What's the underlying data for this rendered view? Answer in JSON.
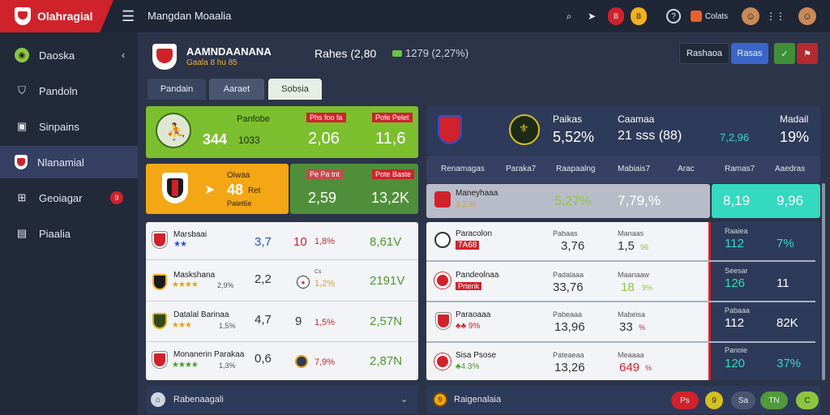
{
  "app": {
    "brand": "Olahragial",
    "page_title": "Mangdan Moaalia"
  },
  "topbar_icons": [
    {
      "name": "search-icon",
      "glyph": "🔍︎"
    },
    {
      "name": "share-icon",
      "glyph": "➤"
    },
    {
      "name": "red-badge-icon",
      "glyph": "B"
    },
    {
      "name": "coin-icon",
      "glyph": "B"
    },
    {
      "name": "help-icon",
      "glyph": "?"
    }
  ],
  "topbar_button": {
    "label": "Colats"
  },
  "sidebar": {
    "items": [
      {
        "label": "Daoska",
        "icon": "dashboard-icon",
        "arrow": "‹"
      },
      {
        "label": "Pandoln",
        "icon": "shield-outline-icon"
      },
      {
        "label": "Sinpains",
        "icon": "briefcase-icon"
      },
      {
        "label": "Nlanamial",
        "icon": "club-shield-icon"
      },
      {
        "label": "Geoiagar",
        "icon": "gamepad-icon",
        "badge": "9"
      },
      {
        "label": "Piaalia",
        "icon": "document-icon"
      }
    ]
  },
  "header": {
    "team": "AAMNDAANANA",
    "subtitle": "Gaala 8 hu 85",
    "stat": "Rahes (2,80",
    "stat2": "1279 (2,27%)",
    "buttons": [
      "Rashaoa",
      "Rasas"
    ],
    "icon_buttons": [
      "check-icon",
      "bookmark-icon"
    ]
  },
  "tabs": [
    "Pandain",
    "Aaraet",
    "Sobsia"
  ],
  "cards": [
    {
      "title": "Panfobe",
      "big": "344",
      "small": "1033",
      "chip1": "Phs foo fa",
      "chip2": "Pofe Pelet",
      "val1": "2,06",
      "val2": "11,6"
    },
    {
      "title": "Oiwaa",
      "big": "48",
      "small": "Ret",
      "sub": "Paiet6e",
      "chip1": "Pe Pa tnt",
      "chip2": "Pote Baste",
      "val1": "2,59",
      "val2": "13,2K"
    }
  ],
  "left_rows": [
    {
      "name": "Marsbaai",
      "stars": "★★",
      "rating": "",
      "val": "3,7",
      "val2": "10",
      "pct": "1,8%",
      "total": "8,61V"
    },
    {
      "name": "Maskshana",
      "stars": "★★★★",
      "rating": "2,9%",
      "val": "2,2",
      "val2": "Cs",
      "pct": "1,2%",
      "total": "2191V"
    },
    {
      "name": "Datalal Barinaa",
      "stars": "★★★",
      "rating": "1,5%",
      "val": "4,7",
      "val2": "9",
      "pct": "1,5%",
      "total": "2,57N"
    },
    {
      "name": "Monanerin Parakaa",
      "stars": "★★★★",
      "rating": "1,3%",
      "val": "0,6",
      "val2": "",
      "pct": "7,9%",
      "total": "2,87N"
    }
  ],
  "right_header": {
    "title": "Paikas",
    "pct": "5,52%",
    "col2_title": "Caamaa",
    "col2_val": "21 sss (88)",
    "col3_title": "Madail",
    "col3_green": "7,2,96",
    "col3_val": "19%"
  },
  "table_headers": [
    "Renamagas",
    "Paraka7",
    "Raapaalng",
    "Mabiais7",
    "Arac",
    "Ramas7",
    "Aaedras"
  ],
  "right_rows": [
    {
      "name": "Maneyhaaa",
      "sub": "3,2,%",
      "c2": "5,27%",
      "c3": "7,79,%",
      "r1": "8,19",
      "r2": "9,96"
    },
    {
      "name": "Paracolon",
      "sub": "7A68",
      "c2lab": "Pabaas",
      "c2": "3,76",
      "c3lab": "Manaas",
      "c3": "1,5",
      "c3s": "96",
      "r1lab": "Raaiea",
      "r1": "112",
      "r2": "7%"
    },
    {
      "name": "Pandeolnaa",
      "sub": "Prtenk",
      "c2lab": "Padalaaa",
      "c2": "33,76",
      "c3lab": "Maanaaw",
      "c3": "18",
      "c3s": "9%",
      "r1lab": "Seesar",
      "r1": "126",
      "r2": "11"
    },
    {
      "name": "Paraoaaa",
      "sub": "9%",
      "c2lab": "Pabeaaa",
      "c2": "13,96",
      "c3lab": "Mabeisa",
      "c3": "33",
      "c3s": "%",
      "r1lab": "Pabaaa",
      "r1": "112",
      "r2": "82K"
    },
    {
      "name": "Sisa Psose",
      "sub": "3%",
      "c2lab": "Pateaeaa",
      "c2": "13,26",
      "c3lab": "Meaaaa",
      "c3": "649",
      "c3s": "%",
      "r1lab": "Panoie",
      "r1": "120",
      "r2": "37%"
    }
  ],
  "footer_left": "Rabenaagali",
  "footer_right": "Raigenalaia",
  "footer_right_buttons": [
    "Ps",
    "9",
    "Sa",
    "TN",
    "C"
  ],
  "colors": {
    "red": "#d0222b",
    "green": "#6cc24a",
    "yellow": "#f3a714",
    "teal": "#34d9c0",
    "navy": "#2e3a59"
  }
}
